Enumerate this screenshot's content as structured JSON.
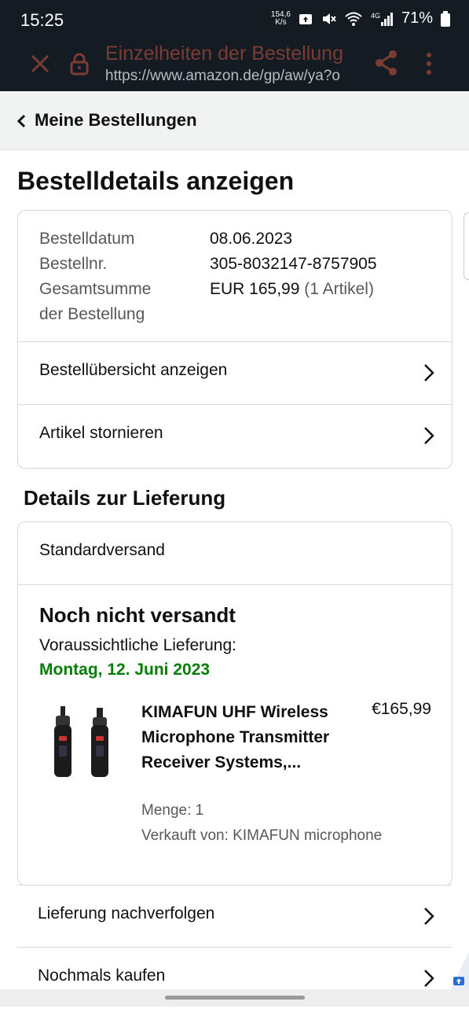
{
  "status_bar": {
    "time": "15:25",
    "net_speed_top": "154,6",
    "net_speed_unit": "K/s",
    "network": "4G",
    "battery": "71%"
  },
  "browser": {
    "title": "Einzelheiten der Bestellung",
    "url": "https://www.amazon.de/gp/aw/ya?o"
  },
  "nav": {
    "back_label": "Meine Bestellungen"
  },
  "page": {
    "title": "Bestelldetails anzeigen"
  },
  "order": {
    "date_label": "Bestelldatum",
    "date_value": "08.06.2023",
    "number_label": "Bestellnr.",
    "number_value": "305-8032147-8757905",
    "total_label_1": "Gesamtsumme",
    "total_label_2": "der Bestellung",
    "total_value": "EUR 165,99",
    "total_items": "(1 Artikel)",
    "links": [
      "Bestellübersicht anzeigen",
      "Artikel stornieren"
    ]
  },
  "delivery": {
    "heading": "Details zur Lieferung",
    "shipping_type": "Standardversand",
    "status": "Noch nicht versandt",
    "expected_label": "Voraussichtliche Lieferung:",
    "expected_date": "Montag, 12. Juni 2023",
    "status_color": "#067d06",
    "item": {
      "name": "KIMAFUN UHF Wireless Microphone Transmitter Receiver Systems,...",
      "price": "€165,99",
      "quantity": "Menge: 1",
      "seller": "Verkauft von: KIMAFUN microphone"
    }
  },
  "actions": [
    "Lieferung nachverfolgen",
    "Nochmals kaufen"
  ]
}
